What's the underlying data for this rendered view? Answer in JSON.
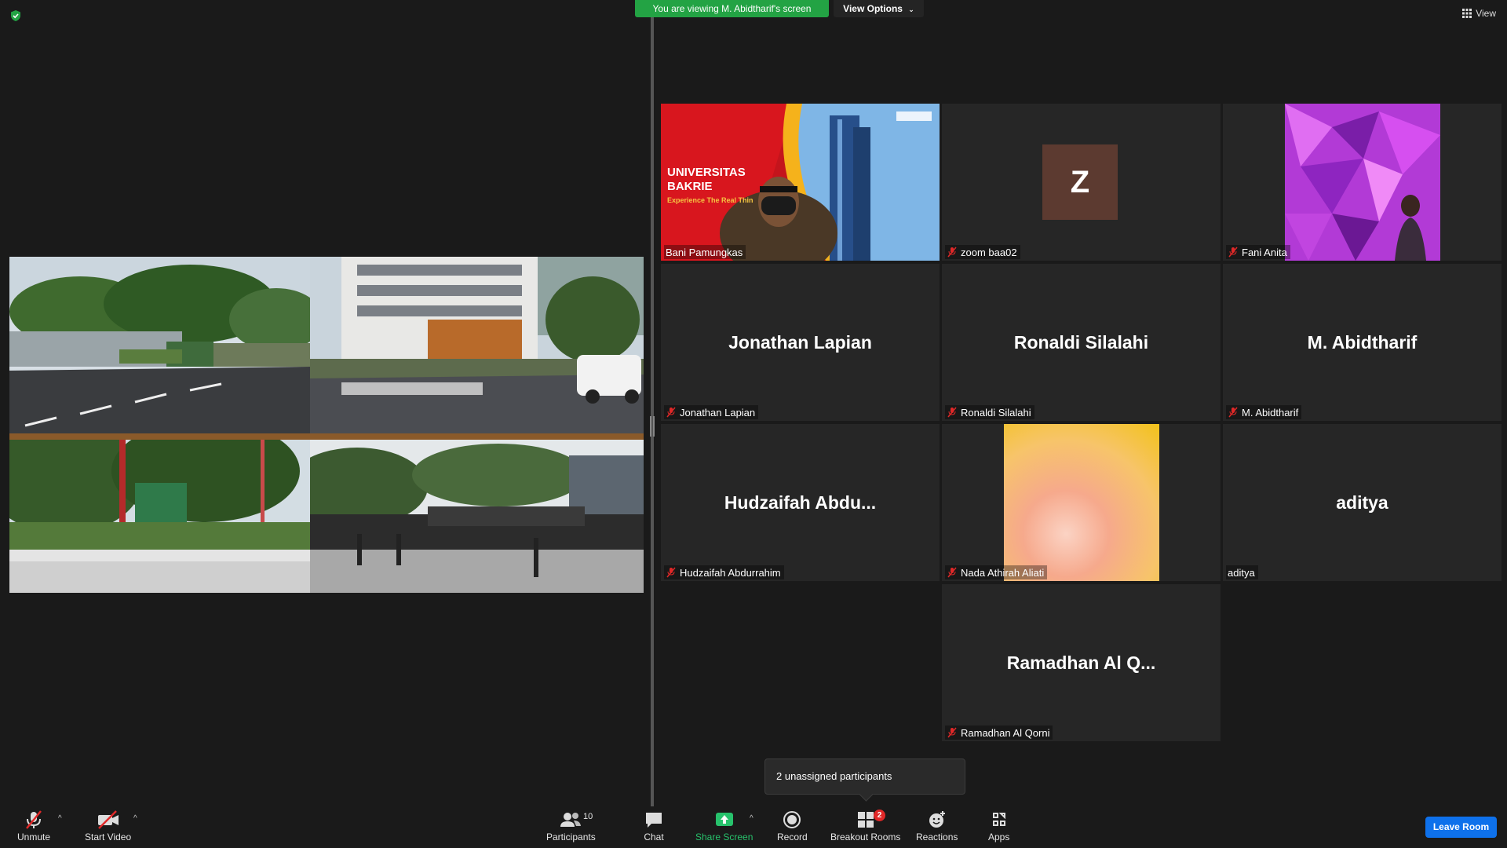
{
  "top": {
    "viewing_banner": "You are viewing M. Abidtharif's screen",
    "view_options": "View Options",
    "view_label": "View"
  },
  "participants": [
    {
      "tile_name": "",
      "label": "Bani Pamungkas",
      "type": "video-presenter",
      "muted": false,
      "active": true
    },
    {
      "tile_name": "Z",
      "label": "zoom baa02",
      "type": "avatar",
      "muted": true
    },
    {
      "tile_name": "",
      "label": "Fani Anita",
      "type": "photo",
      "muted": true
    },
    {
      "tile_name": "Jonathan Lapian",
      "label": "Jonathan Lapian",
      "type": "name",
      "muted": true
    },
    {
      "tile_name": "Ronaldi Silalahi",
      "label": "Ronaldi Silalahi",
      "type": "name",
      "muted": true
    },
    {
      "tile_name": "M. Abidtharif",
      "label": "M. Abidtharif",
      "type": "name",
      "muted": true
    },
    {
      "tile_name": "Hudzaifah  Abdu...",
      "label": "Hudzaifah Abdurrahim",
      "type": "name",
      "muted": true
    },
    {
      "tile_name": "",
      "label": "Nada Athirah Aliati",
      "type": "gradient",
      "muted": true
    },
    {
      "tile_name": "aditya",
      "label": "aditya",
      "type": "name",
      "muted": false
    },
    {
      "tile_name": "Ramadhan Al Q...",
      "label": "Ramadhan Al Qorni",
      "type": "name",
      "muted": true
    }
  ],
  "presenter_slide": {
    "line1": "UNIVERSITAS",
    "line2": "BAKRIE",
    "tagline": "Experience The Real Thin"
  },
  "toast": "2 unassigned participants",
  "toolbar": {
    "unmute": "Unmute",
    "start_video": "Start Video",
    "participants": "Participants",
    "participants_count": "10",
    "chat": "Chat",
    "share_screen": "Share Screen",
    "record": "Record",
    "breakout_rooms": "Breakout Rooms",
    "breakout_badge": "2",
    "reactions": "Reactions",
    "apps": "Apps",
    "leave_room": "Leave Room"
  },
  "colors": {
    "banner_green": "#23a344",
    "active_speaker": "#e2e43a",
    "leave_blue": "#0e71eb",
    "muted_red": "#e02828",
    "share_green": "#27c26c"
  }
}
